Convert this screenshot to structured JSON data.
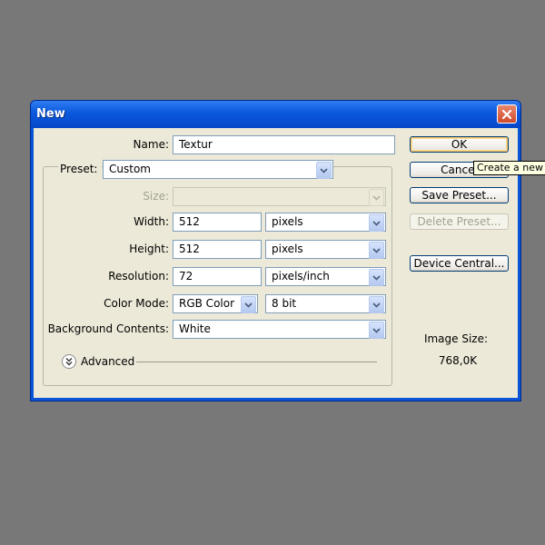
{
  "window": {
    "title": "New"
  },
  "fields": {
    "name": {
      "label": "Name:",
      "value": "Textur"
    },
    "preset": {
      "label": "Preset:",
      "value": "Custom"
    },
    "size": {
      "label": "Size:",
      "value": ""
    },
    "width": {
      "label": "Width:",
      "value": "512",
      "unit": "pixels"
    },
    "height": {
      "label": "Height:",
      "value": "512",
      "unit": "pixels"
    },
    "resolution": {
      "label": "Resolution:",
      "value": "72",
      "unit": "pixels/inch"
    },
    "color_mode": {
      "label": "Color Mode:",
      "value": "RGB Color",
      "depth": "8 bit"
    },
    "background": {
      "label": "Background Contents:",
      "value": "White"
    }
  },
  "advanced": {
    "label": "Advanced"
  },
  "buttons": {
    "ok": "OK",
    "cancel": "Cancel",
    "save_preset": "Save Preset...",
    "delete_preset": "Delete Preset...",
    "device_central": "Device Central..."
  },
  "tooltip": "Create a new document",
  "image_size": {
    "label": "Image Size:",
    "value": "768,0K"
  }
}
